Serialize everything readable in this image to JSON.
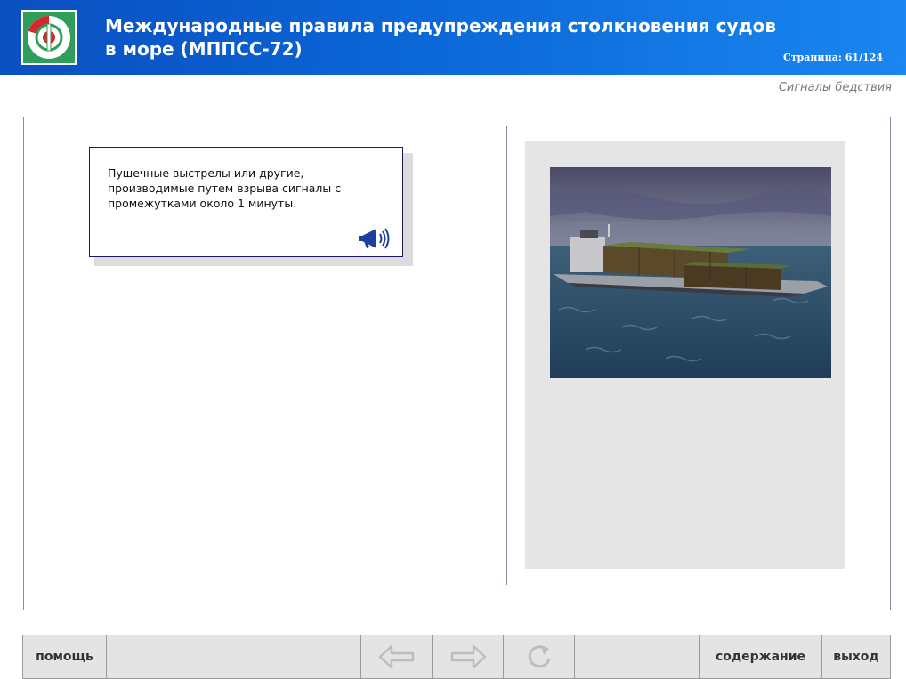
{
  "header": {
    "title_line1": "Международные правила предупреждения столкновения судов",
    "title_line2": "в море (МППСС-72)",
    "page_indicator": "Страница: 61/124",
    "section_title": "Сигналы бедствия"
  },
  "card": {
    "text": "Пушечные выстрелы или другие, производимые путем взрыва сигналы с промежутками около 1 минуты."
  },
  "navigation": {
    "help": "помощь",
    "contents": "содержание",
    "exit": "выход"
  },
  "colors": {
    "header_start": "#0a4fc0",
    "header_end": "#1a86f0",
    "nav_bg": "#e4e4e4",
    "panel_border": "#8a8aa8"
  },
  "icons": [
    "logo-emblem",
    "megaphone-icon",
    "arrow-left-icon",
    "arrow-right-icon",
    "reload-icon"
  ]
}
